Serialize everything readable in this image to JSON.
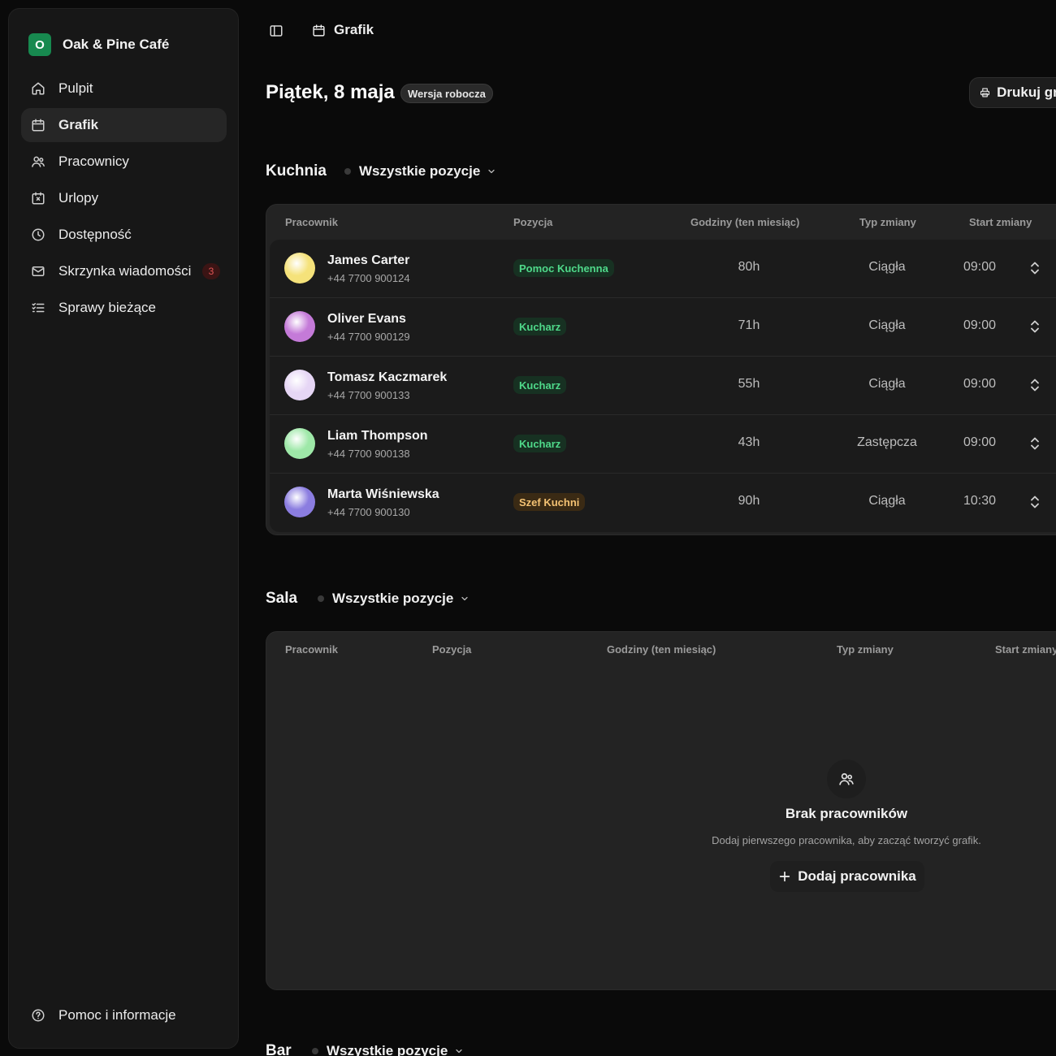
{
  "brand": {
    "logo_letter": "O",
    "name": "Oak & Pine Café"
  },
  "nav": {
    "items": [
      {
        "label": "Pulpit"
      },
      {
        "label": "Grafik"
      },
      {
        "label": "Pracownicy"
      },
      {
        "label": "Urlopy"
      },
      {
        "label": "Dostępność"
      },
      {
        "label": "Skrzynka wiadomości",
        "badge": "3"
      },
      {
        "label": "Sprawy bieżące"
      }
    ],
    "active": "Grafik",
    "help_label": "Pomoc i informacje"
  },
  "topbar": {
    "breadcrumb": "Grafik"
  },
  "header": {
    "title": "Piątek, 8 maja",
    "status_badge": "Wersja robocza",
    "print_label": "Drukuj grafik"
  },
  "sections": [
    {
      "title": "Kuchnia",
      "filter": "Wszystkie pozycje",
      "columns": [
        "Pracownik",
        "Pozycja",
        "Godziny (ten miesiąc)",
        "Typ zmiany",
        "Start zmiany"
      ],
      "rows": [
        {
          "name": "James Carter",
          "phone": "+44 7700 900124",
          "position": "Pomoc Kuchenna",
          "hours": "80h",
          "shift_type": "Ciągła",
          "start": "09:00",
          "avatar_color": "#f5e27a",
          "badge": "green"
        },
        {
          "name": "Oliver Evans",
          "phone": "+44 7700 900129",
          "position": "Kucharz",
          "hours": "71h",
          "shift_type": "Ciągła",
          "start": "09:00",
          "avatar_color": "#c47ad8",
          "badge": "green"
        },
        {
          "name": "Tomasz Kaczmarek",
          "phone": "+44 7700 900133",
          "position": "Kucharz",
          "hours": "55h",
          "shift_type": "Ciągła",
          "start": "09:00",
          "avatar_color": "#e6d6f5",
          "badge": "green"
        },
        {
          "name": "Liam Thompson",
          "phone": "+44 7700 900138",
          "position": "Kucharz",
          "hours": "43h",
          "shift_type": "Zastępcza",
          "start": "09:00",
          "avatar_color": "#9ee8a8",
          "badge": "green"
        },
        {
          "name": "Marta Wiśniewska",
          "phone": "+44 7700 900130",
          "position": "Szef Kuchni",
          "hours": "90h",
          "shift_type": "Ciągła",
          "start": "10:30",
          "avatar_color": "#8b7de0",
          "badge": "amber"
        }
      ]
    },
    {
      "title": "Sala",
      "filter": "Wszystkie pozycje",
      "columns": [
        "Pracownik",
        "Pozycja",
        "Godziny (ten miesiąc)",
        "Typ zmiany",
        "Start zmiany"
      ],
      "empty": {
        "title": "Brak pracowników",
        "subtitle": "Dodaj pierwszego pracownika, aby zacząć tworzyć grafik.",
        "action": "Dodaj pracownika"
      }
    },
    {
      "title": "Bar",
      "filter": "Wszystkie pozycje"
    }
  ]
}
